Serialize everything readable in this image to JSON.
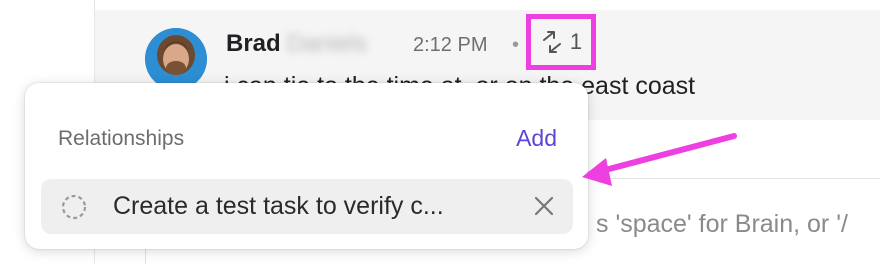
{
  "message": {
    "sender": "Brad",
    "sender_last_name_blurred": "Daniels",
    "time": "2:12 PM",
    "separator": "•",
    "relationship_count": "1",
    "text": "i can tie to the time at, or on the east coast"
  },
  "popover": {
    "title": "Relationships",
    "add_label": "Add",
    "task": {
      "title": "Create a test task to verify c..."
    }
  },
  "composer": {
    "placeholder_tail": "s 'space' for Brain, or '/"
  },
  "annotation": {
    "highlight_color": "#ee3fe0",
    "arrow_color": "#ee3fe0"
  }
}
